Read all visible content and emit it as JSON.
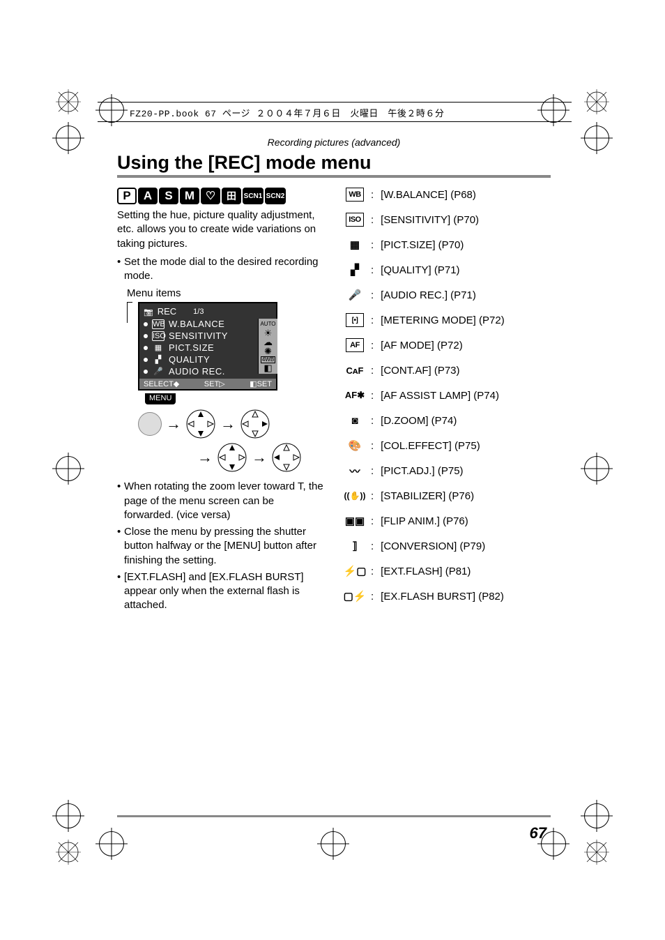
{
  "book_header": "FZ20-PP.book  67 ページ  ２００４年７月６日　火曜日　午後２時６分",
  "section_header": "Recording pictures (advanced)",
  "title": "Using the [REC] mode menu",
  "mode_badges": [
    "P",
    "A",
    "S",
    "M",
    "♡",
    "⽥",
    "SCN1",
    "SCN2"
  ],
  "intro": "Setting the hue, picture quality adjustment, etc. allows you to create wide variations on taking pictures.",
  "bullets_top": [
    "Set the mode dial to the desired recording mode."
  ],
  "menu_items_label": "Menu items",
  "lcd": {
    "title": "REC",
    "page": "1/3",
    "side_top": "AUTO",
    "rows": [
      "W.BALANCE",
      "SENSITIVITY",
      "PICT.SIZE",
      "QUALITY",
      "AUDIO REC."
    ],
    "row_icons": [
      "WB",
      "ISO",
      "▦",
      "▞",
      "🎤"
    ],
    "side_icons": [
      "☀",
      "☁",
      "✺",
      "4WB",
      "◧"
    ],
    "footer_left": "SELECT",
    "footer_mid": "SET",
    "footer_right": "SET",
    "menu_tag": "MENU"
  },
  "bullets_bottom": [
    "When rotating the zoom lever toward T, the page of the menu screen can be forwarded. (vice versa)",
    "Close the menu by pressing the shutter button halfway or the [MENU] button after finishing the setting.",
    "[EXT.FLASH] and [EX.FLASH BURST] appear only when the external flash is attached."
  ],
  "ref_list": [
    {
      "icon_text": "WB",
      "icon_class": "box",
      "label": "[W.BALANCE] (P68)"
    },
    {
      "icon_text": "ISO",
      "icon_class": "box",
      "label": "[SENSITIVITY] (P70)"
    },
    {
      "icon_text": "▦",
      "icon_class": "txt",
      "label": "[PICT.SIZE] (P70)"
    },
    {
      "icon_text": "▞",
      "icon_class": "txt",
      "label": "[QUALITY] (P71)"
    },
    {
      "icon_text": "🎤",
      "icon_class": "txt",
      "label": "[AUDIO REC.] (P71)"
    },
    {
      "icon_text": "[•]",
      "icon_class": "box",
      "label": "[METERING MODE] (P72)"
    },
    {
      "icon_text": "AF",
      "icon_class": "box",
      "label": "[AF MODE] (P72)"
    },
    {
      "icon_text": "CᴀF",
      "icon_class": "txt",
      "label": "[CONT.AF] (P73)"
    },
    {
      "icon_text": "AF✱",
      "icon_class": "txt",
      "label": "[AF ASSIST LAMP] (P74)"
    },
    {
      "icon_text": "◙",
      "icon_class": "txt",
      "label": "[D.ZOOM] (P74)"
    },
    {
      "icon_text": "🎨",
      "icon_class": "txt",
      "label": "[COL.EFFECT] (P75)"
    },
    {
      "icon_text": "〰",
      "icon_class": "txt",
      "label": "[PICT.ADJ.] (P75)"
    },
    {
      "icon_text": "((✋))",
      "icon_class": "txt",
      "label": "[STABILIZER] (P76)"
    },
    {
      "icon_text": "▣▣",
      "icon_class": "txt",
      "label": "[FLIP ANIM.] (P76)"
    },
    {
      "icon_text": "⟧",
      "icon_class": "txt",
      "label": "[CONVERSION] (P79)"
    },
    {
      "icon_text": "⚡▢",
      "icon_class": "txt",
      "label": "[EXT.FLASH] (P81)"
    },
    {
      "icon_text": "▢⚡",
      "icon_class": "txt",
      "label": "[EX.FLASH BURST] (P82)"
    }
  ],
  "page_number": "67"
}
